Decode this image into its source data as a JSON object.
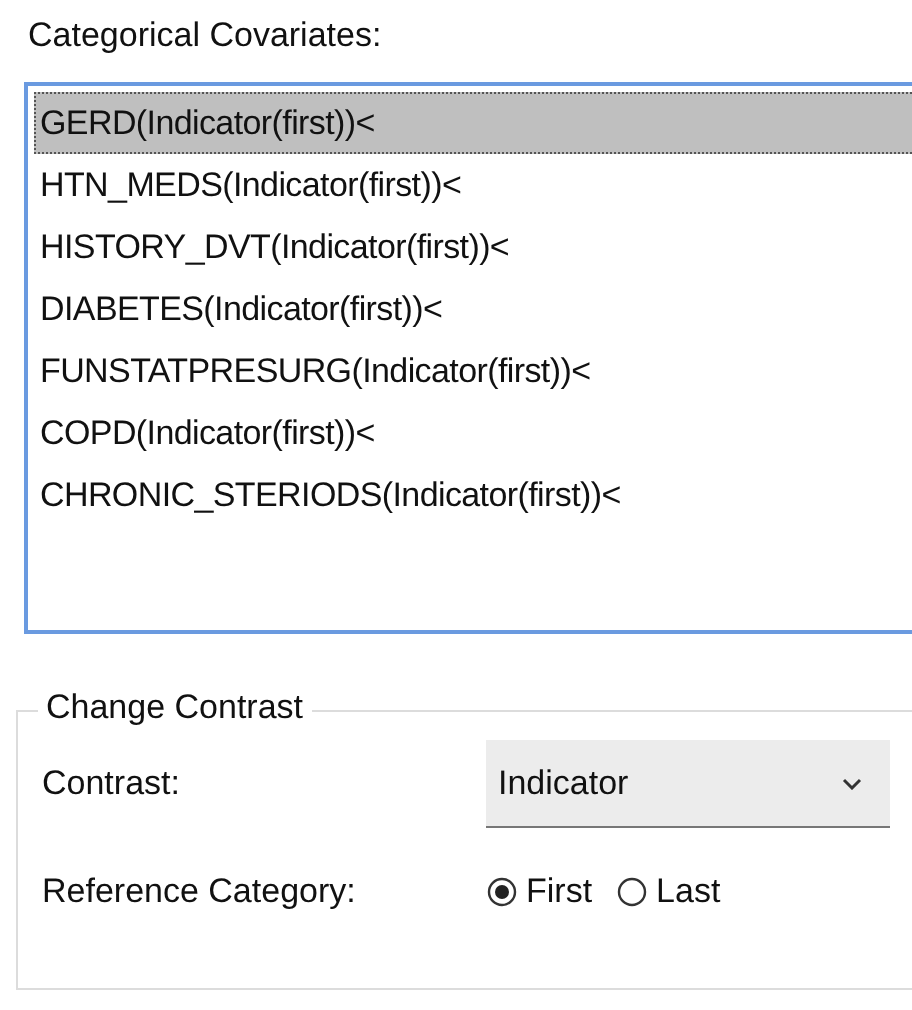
{
  "label": "Categorical Covariates:",
  "covariates": [
    {
      "name": "GERD(Indicator(first))<",
      "selected": true
    },
    {
      "name": "HTN_MEDS(Indicator(first))<",
      "selected": false
    },
    {
      "name": "HISTORY_DVT(Indicator(first))<",
      "selected": false
    },
    {
      "name": "DIABETES(Indicator(first))<",
      "selected": false
    },
    {
      "name": "FUNSTATPRESURG(Indicator(first))<",
      "selected": false
    },
    {
      "name": "COPD(Indicator(first))<",
      "selected": false
    },
    {
      "name": "CHRONIC_STERIODS(Indicator(first))<",
      "selected": false
    }
  ],
  "change_contrast": {
    "title": "Change Contrast",
    "contrast_label": "Contrast:",
    "contrast_value": "Indicator",
    "reference_label": "Reference Category:",
    "reference_options": [
      {
        "label": "First",
        "selected": true
      },
      {
        "label": "Last",
        "selected": false
      }
    ]
  }
}
